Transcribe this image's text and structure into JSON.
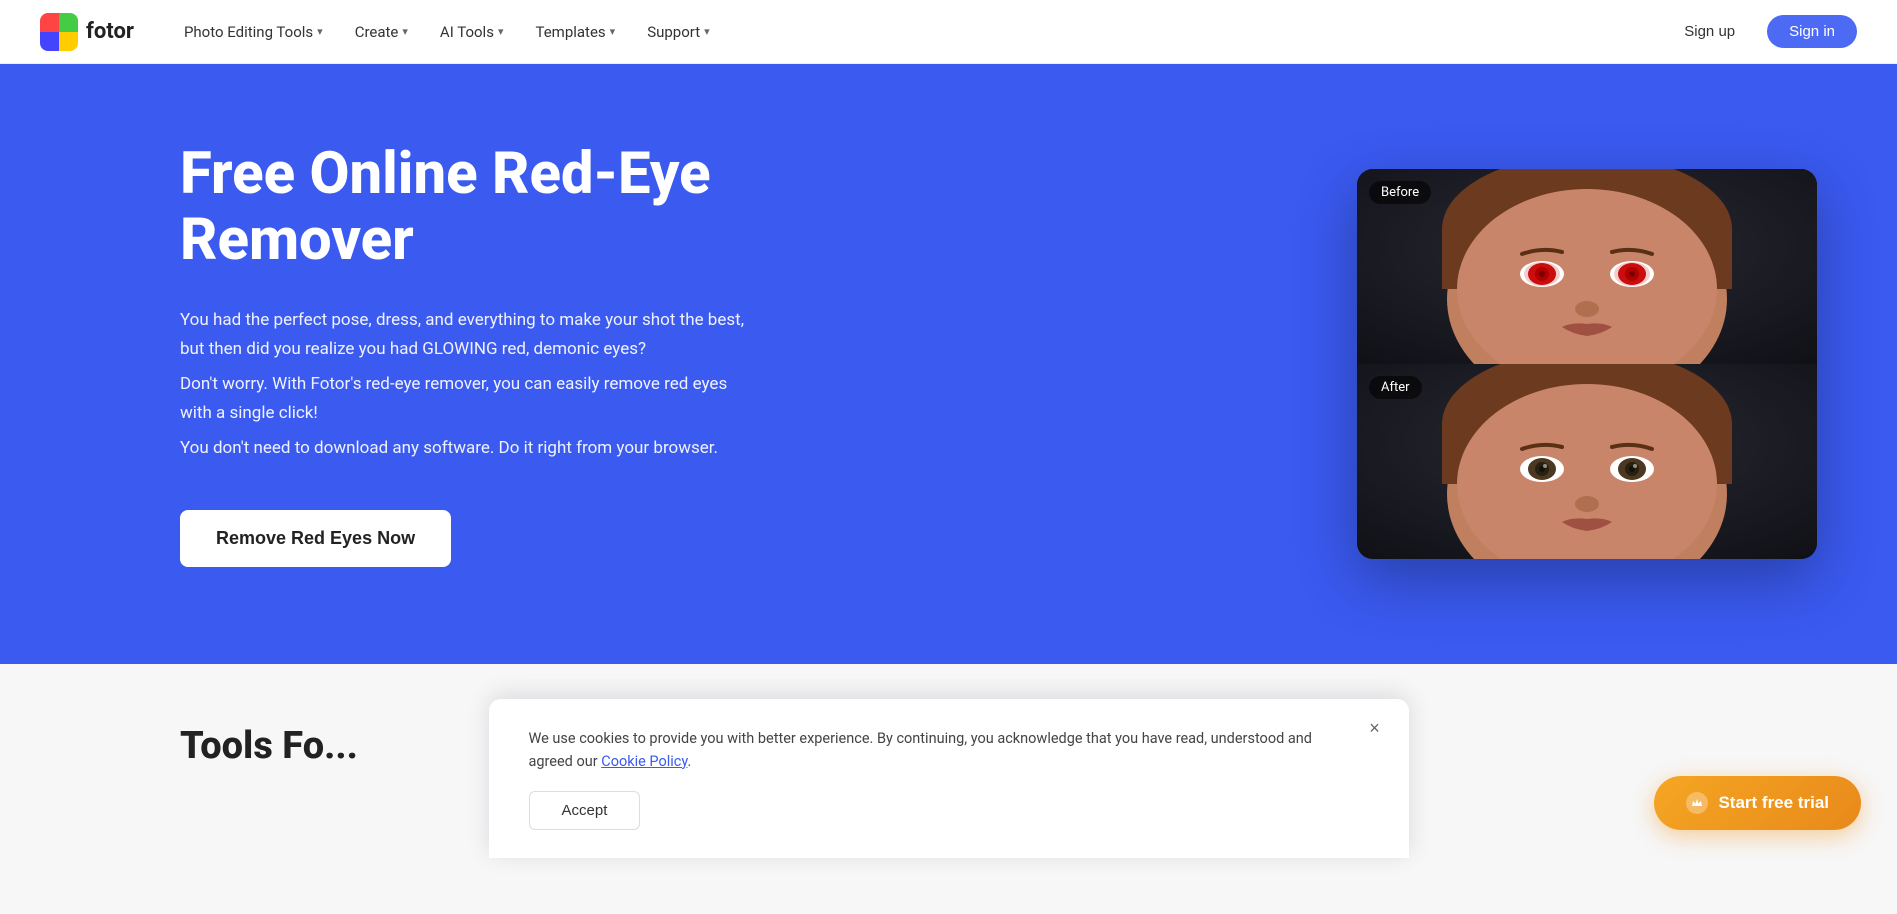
{
  "brand": {
    "name": "fotor",
    "logo_alt": "Fotor logo"
  },
  "navbar": {
    "items": [
      {
        "label": "Photo Editing Tools",
        "has_dropdown": true
      },
      {
        "label": "Create",
        "has_dropdown": true
      },
      {
        "label": "AI Tools",
        "has_dropdown": true
      },
      {
        "label": "Templates",
        "has_dropdown": true
      },
      {
        "label": "Support",
        "has_dropdown": true
      }
    ],
    "signup_label": "Sign up",
    "signin_label": "Sign in"
  },
  "hero": {
    "title": "Free Online Red-Eye Remover",
    "description_1": "You had the perfect pose, dress, and everything to make your shot the best, but then did you realize you had GLOWING red, demonic eyes?",
    "description_2": "Don't worry. With Fotor's red-eye remover, you can easily remove red eyes with a single click!",
    "description_3": "You don't need to download any software. Do it right from your browser.",
    "cta_label": "Remove Red Eyes Now",
    "before_label": "Before",
    "after_label": "After"
  },
  "below_fold": {
    "title": "Tools Fo..."
  },
  "cookie_banner": {
    "text": "We use cookies to provide you with better experience. By continuing, you acknowledge that you have read, understood and agreed our",
    "link_text": "Cookie Policy",
    "link_suffix": ".",
    "accept_label": "Accept",
    "close_icon": "×"
  },
  "trial_button": {
    "label": "Start free trial",
    "icon": "★"
  }
}
